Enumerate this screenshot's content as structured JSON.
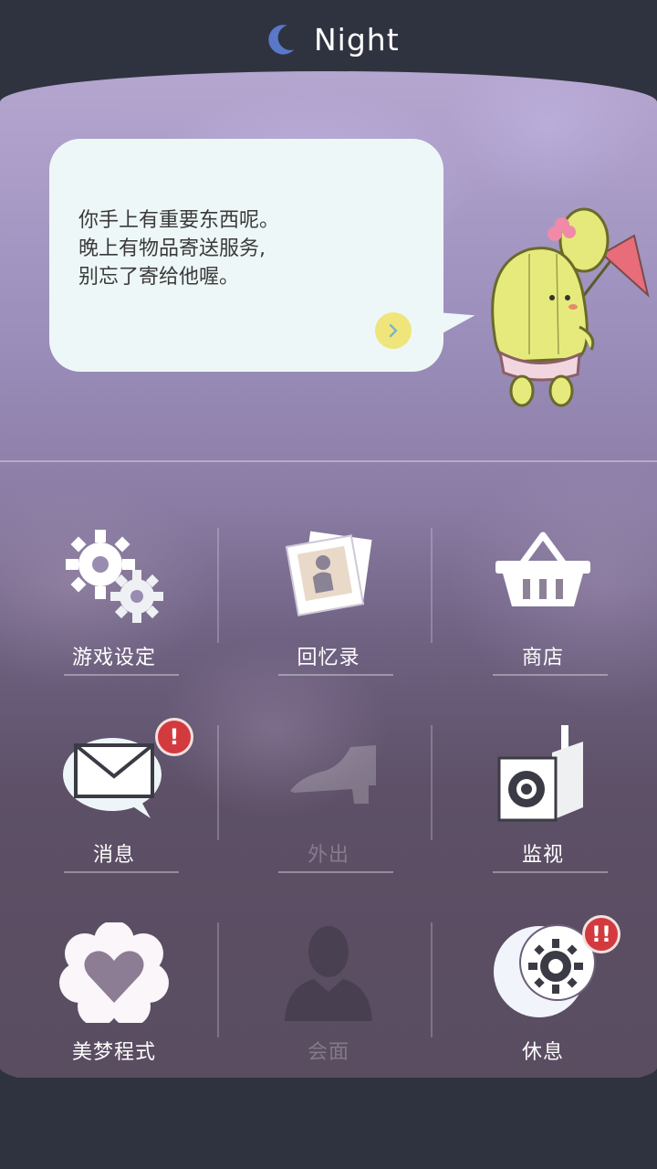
{
  "header": {
    "title": "Night",
    "icon": "crescent-moon-icon",
    "accent_color": "#5a78c8"
  },
  "speech": {
    "text": "你手上有重要东西呢。\n晚上有物品寄送服务,\n别忘了寄给他喔。",
    "next_icon": "chevron-right-icon",
    "bubble_color": "#eef7f8",
    "next_color": "#efe57a"
  },
  "mascot": {
    "name": "cactus-character",
    "icon": "cactus-mascot-icon"
  },
  "menu": {
    "items": [
      {
        "label": "游戏设定",
        "icon": "gears-icon",
        "enabled": true
      },
      {
        "label": "回忆录",
        "icon": "photo-album-icon",
        "enabled": true
      },
      {
        "label": "商店",
        "icon": "shopping-basket-icon",
        "enabled": true
      },
      {
        "label": "消息",
        "icon": "mail-bubble-icon",
        "enabled": true,
        "badge": "!"
      },
      {
        "label": "外出",
        "icon": "shoe-icon",
        "enabled": false
      },
      {
        "label": "监视",
        "icon": "camera-icon",
        "enabled": true
      },
      {
        "label": "美梦程式",
        "icon": "heart-flower-icon",
        "enabled": true
      },
      {
        "label": "会面",
        "icon": "person-silhouette-icon",
        "enabled": false
      },
      {
        "label": "休息",
        "icon": "moon-sun-icon",
        "enabled": true,
        "badge": "!!"
      }
    ]
  },
  "colors": {
    "badge": "#d33a3e",
    "background_dark": "#2f3340"
  }
}
